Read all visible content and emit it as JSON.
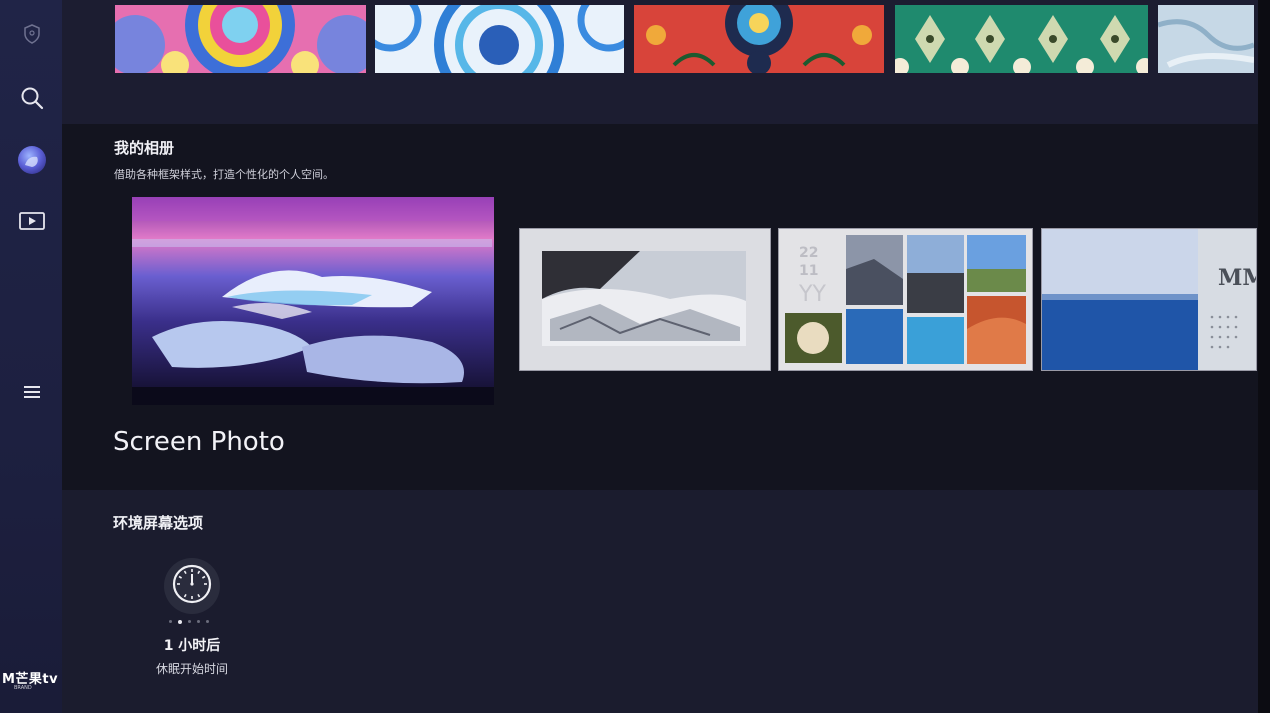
{
  "sidebar": {
    "items": [
      {
        "icon": "shield-icon"
      },
      {
        "icon": "search-icon"
      },
      {
        "icon": "profile-avatar-icon"
      },
      {
        "icon": "play-icon"
      },
      {
        "icon": "menu-icon"
      }
    ],
    "brand": {
      "name": "M芒果tv",
      "sub": "BRAND"
    }
  },
  "top_row": {
    "tiles": [
      {
        "name": "pattern-kaleidoscope-pink"
      },
      {
        "name": "pattern-kaleidoscope-blue"
      },
      {
        "name": "pattern-folk-red"
      },
      {
        "name": "pattern-tiles-green"
      },
      {
        "name": "pattern-marble-blue"
      }
    ]
  },
  "album": {
    "title": "我的相册",
    "subtitle": "借助各种框架样式，打造个性化的个人空间。",
    "feature_title": "Screen Photo",
    "frames": [
      {
        "name": "iceberg-photo"
      },
      {
        "name": "glacier-framed"
      },
      {
        "name": "collage-grid"
      },
      {
        "name": "ocean-calendar"
      }
    ],
    "collage_text": [
      "22",
      "11",
      "YY"
    ],
    "calendar_text": "MM"
  },
  "ambient": {
    "title": "环境屏幕选项",
    "option": {
      "value": "1 小时后",
      "label": "休眠开始时间",
      "icon": "clock-icon"
    },
    "page_dots": 5,
    "active_dot": 1
  }
}
